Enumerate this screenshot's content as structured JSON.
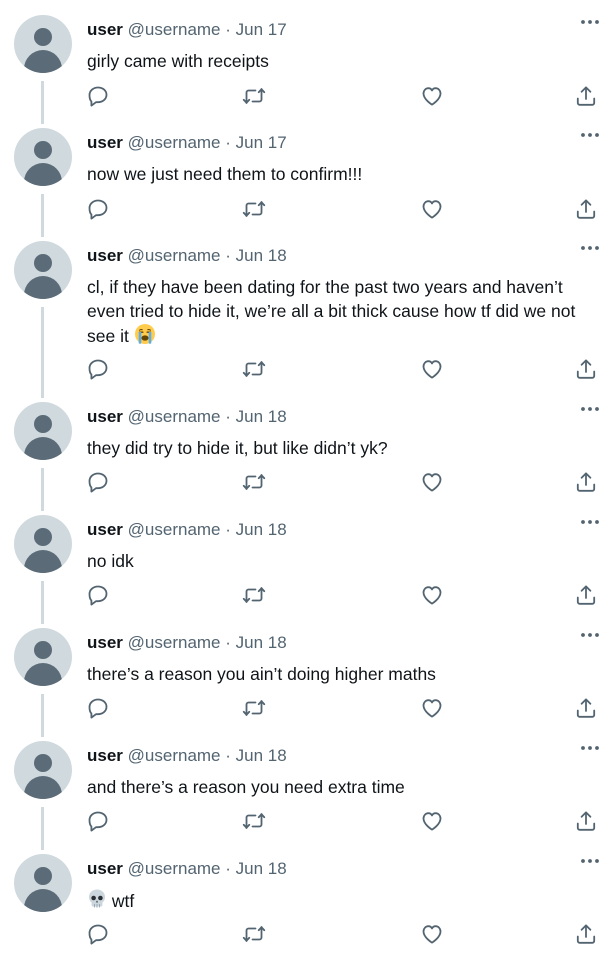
{
  "tweets": [
    {
      "name": "user",
      "handle": "@username",
      "separator": "·",
      "date": "Jun 17",
      "text": "girly came with receipts"
    },
    {
      "name": "user",
      "handle": "@username",
      "separator": "·",
      "date": "Jun 17",
      "text": "now we just need them to confirm!!!"
    },
    {
      "name": "user",
      "handle": "@username",
      "separator": "·",
      "date": "Jun 18",
      "text": "cl, if they have been dating for the past two years and haven’t even tried to hide it, we’re all a bit thick cause how tf did we not see it",
      "trailing_emoji": "loudly-crying-face-emoji"
    },
    {
      "name": "user",
      "handle": "@username",
      "separator": "·",
      "date": "Jun 18",
      "text": "they did try to hide it, but like didn’t yk?"
    },
    {
      "name": "user",
      "handle": "@username",
      "separator": "·",
      "date": "Jun 18",
      "text": "no idk"
    },
    {
      "name": "user",
      "handle": "@username",
      "separator": "·",
      "date": "Jun 18",
      "text": "there’s a reason you ain’t doing higher maths"
    },
    {
      "name": "user",
      "handle": "@username",
      "separator": "·",
      "date": "Jun 18",
      "text": "and there’s a reason you need extra time"
    },
    {
      "name": "user",
      "handle": "@username",
      "separator": "·",
      "date": "Jun 18",
      "text": "wtf",
      "leading_emoji": "skull-emoji"
    }
  ],
  "icons": {
    "more": "more-horizontal-icon",
    "reply": "reply-icon",
    "retweet": "retweet-icon",
    "like": "like-heart-icon",
    "share": "share-icon"
  },
  "colors": {
    "text": "#0f1419",
    "secondary": "#536471",
    "thread_line": "#cfd9de",
    "avatar_bg": "#cfd9de",
    "avatar_fg": "#5b6b78"
  }
}
